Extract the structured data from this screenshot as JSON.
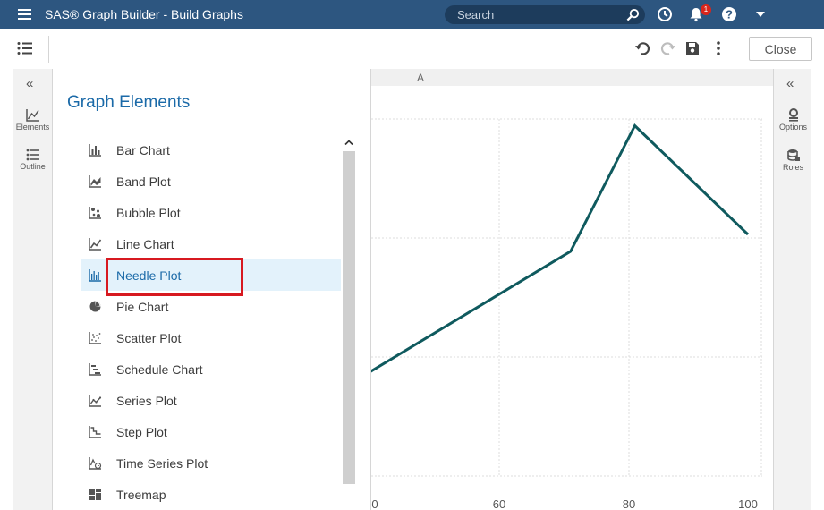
{
  "app": {
    "title": "SAS® Graph Builder - Build Graphs"
  },
  "search": {
    "placeholder": "Search"
  },
  "notifications": {
    "count": "1"
  },
  "toolbar": {
    "close_label": "Close"
  },
  "left_rail": {
    "collapse": "«",
    "items": [
      {
        "label": "Elements",
        "icon": "line-chart-icon"
      },
      {
        "label": "Outline",
        "icon": "list-icon"
      }
    ]
  },
  "right_rail": {
    "collapse": "«",
    "items": [
      {
        "label": "Options",
        "icon": "options-icon"
      },
      {
        "label": "Roles",
        "icon": "roles-icon"
      }
    ]
  },
  "pane": {
    "title": "Graph Elements",
    "items": [
      {
        "label": "Bar Chart",
        "icon": "bar-chart-icon"
      },
      {
        "label": "Band Plot",
        "icon": "band-plot-icon"
      },
      {
        "label": "Bubble Plot",
        "icon": "bubble-plot-icon"
      },
      {
        "label": "Line Chart",
        "icon": "line-chart-icon"
      },
      {
        "label": "Needle Plot",
        "icon": "needle-plot-icon",
        "selected": true
      },
      {
        "label": "Pie Chart",
        "icon": "pie-chart-icon"
      },
      {
        "label": "Scatter Plot",
        "icon": "scatter-plot-icon"
      },
      {
        "label": "Schedule Chart",
        "icon": "schedule-chart-icon"
      },
      {
        "label": "Series Plot",
        "icon": "series-plot-icon"
      },
      {
        "label": "Step Plot",
        "icon": "step-plot-icon"
      },
      {
        "label": "Time Series Plot",
        "icon": "time-series-plot-icon"
      },
      {
        "label": "Treemap",
        "icon": "treemap-icon"
      }
    ]
  },
  "canvas": {
    "column_header": "A"
  },
  "colors": {
    "topbar": "#2d5680",
    "accent": "#1b6aa8",
    "line": "#0f5a5e",
    "highlight": "#d71920",
    "selected_bg": "#e3f2fb"
  },
  "chart_data": {
    "type": "line",
    "x": [
      40,
      71,
      81,
      100
    ],
    "y": [
      -7,
      43,
      95,
      50
    ],
    "xtick_labels": [
      "0",
      "60",
      "80",
      "100"
    ],
    "grid": true
  }
}
